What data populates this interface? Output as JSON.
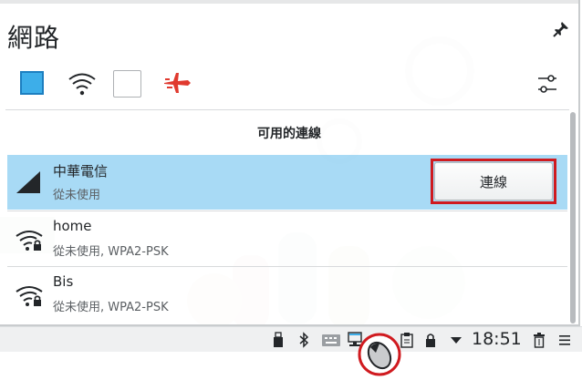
{
  "popup": {
    "title": "網路",
    "section_title": "可用的連線",
    "toolbar": {
      "wired_icon": "wired-toggle-icon",
      "wifi_icon": "wifi-toggle-icon",
      "mobile_icon": "mobile-broadband-toggle-icon",
      "airplane_icon": "airplane-mode-icon",
      "config_icon": "configure-network-icon"
    },
    "connections": [
      {
        "name": "中華電信",
        "status": "從未使用",
        "icon": "cellular-signal-icon",
        "selected": true
      },
      {
        "name": "home",
        "status": "從未使用, WPA2-PSK",
        "icon": "wifi-secured-icon",
        "selected": false
      },
      {
        "name": "Bis",
        "status": "從未使用, WPA2-PSK",
        "icon": "wifi-secured-icon",
        "selected": false
      }
    ],
    "connect_label": "連線"
  },
  "panel": {
    "clock": "18:51",
    "tray_icons": [
      "usb-icon",
      "bluetooth-icon",
      "keyboard-icon",
      "network-icon",
      "volume-icon",
      "clipboard-icon",
      "lock-icon",
      "expand-tray-icon",
      "trash-icon",
      "menu-icon"
    ]
  },
  "colors": {
    "accent": "#3daee9",
    "highlight_border": "#d01a1f",
    "airplane": "#e03a2f",
    "panel_bg": "#eff0f1"
  }
}
